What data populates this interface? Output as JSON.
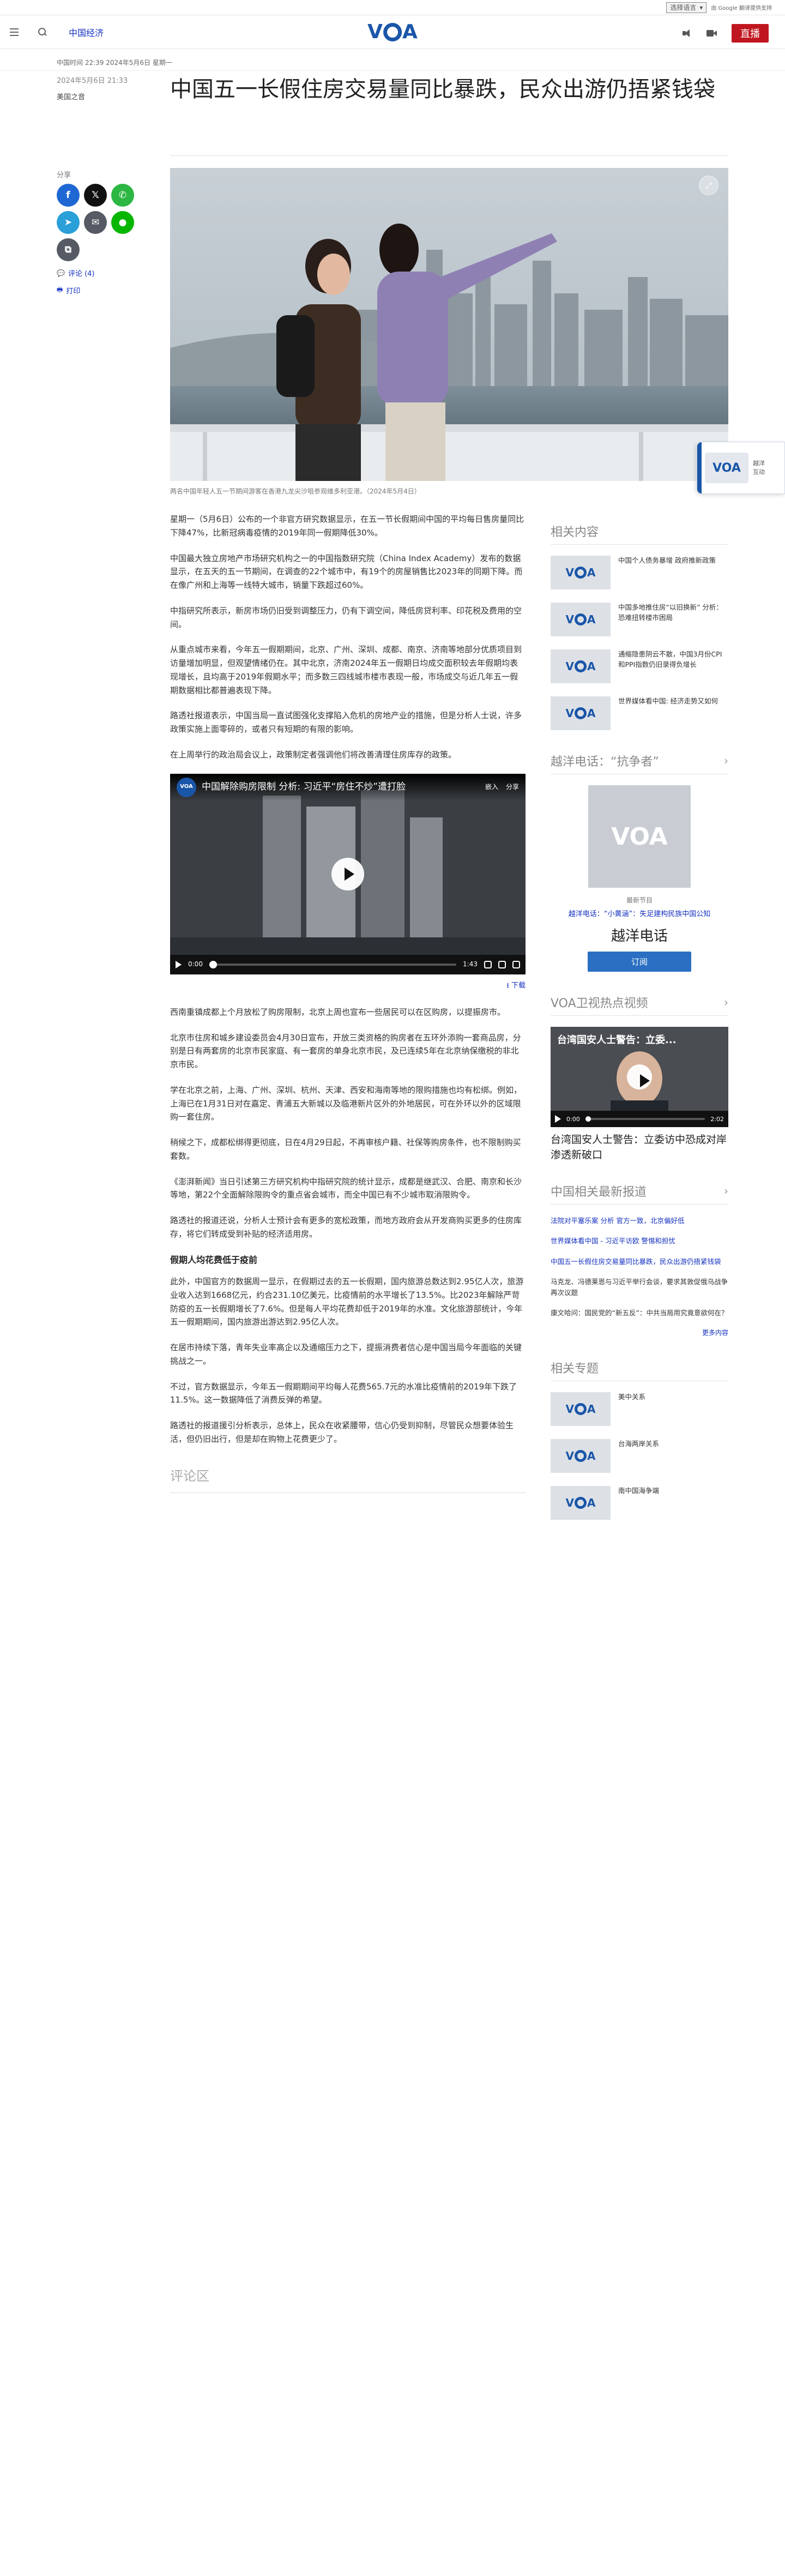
{
  "topbar": {
    "language_select": "选择语言",
    "powered_by": "由 Google 翻译提供支持"
  },
  "header": {
    "section": "中国经济",
    "logo": "VOA",
    "live": "直播"
  },
  "breadcrumb": "中国时间 22:39 2024年5月6日 星期一",
  "article": {
    "date": "2024年5月6日 21:33",
    "location": "美国之音",
    "title": "中国五一长假住房交易量同比暴跌，民众出游仍捂紧钱袋",
    "hero_caption": "两名中国年轻人五一节期间游客在香港九龙尖沙咀参观维多利亚港。（2024年5月4日）",
    "paragraphs_1": [
      "星期一（5月6日）公布的一个非官方研究数据显示，在五一节长假期间中国的平均每日售房量同比下降47%，比新冠病毒疫情的2019年同一假期降低30%。",
      "中国最大独立房地产市场研究机构之一的中国指数研究院（China Index Academy）发布的数据显示，在五天的五一节期间，在调查的22个城市中，有19个的房屋销售比2023年的同期下降。而在像广州和上海等一线特大城市，销量下跌超过60%。",
      "中指研究所表示，新房市场仍旧受到调整压力，仍有下调空间，降低房贷利率、印花税及费用的空间。",
      "从重点城市来看，今年五一假期期间，北京、广州、深圳、成都、南京、济南等地部分优质项目到访量增加明显，但观望情绪仍在。其中北京，济南2024年五一假期日均成交面积较去年假期均表现增长，且均高于2019年假期水平；而多数三四线城市楼市表现一般，市场成交与近几年五一假期数据相比都普遍表现下降。",
      "路透社报道表示，中国当局一直试图强化支撑陷入危机的房地产业的措施，但是分析人士说，许多政策实施上面零碎的，或者只有短期的有限的影响。",
      "在上周举行的政治局会议上，政策制定者强调他们将改善清理住房库存的政策。"
    ],
    "video": {
      "title": "中国解除购房限制 分析: 习近平“房住不炒”遭打脸",
      "embed": "嵌入",
      "share": "分享",
      "time_current": "0:00",
      "time_total": "1:43",
      "download": "下载"
    },
    "paragraphs_2": [
      "西南重镇成都上个月放松了购房限制，北京上周也宣布一些居民可以在区购房，以提振房市。",
      "北京市住房和城乡建设委员会4月30日宣布，开放三类资格的购房者在五环外添购一套商品房，分别是日有两套房的北京市民家庭、有一套房的单身北京市民，及已连续5年在北京纳保缴税的非北京市民。",
      "学在北京之前，上海、广州、深圳、杭州、天津、西安和海南等地的限购措施也均有松绑。例如，上海已在1月31日对在嘉定、青浦五大新城以及临港新片区外的外地居民，可在外环以外的区域限购一套住房。",
      "稍候之下，成都松绑得更彻底，日在4月29日起，不再审核户籍、社保等购房条件，也不限制购买套数。",
      "《澎湃新闻》当日引述第三方研究机构中指研究院的统计显示，成都是继武汉、合肥、南京和长沙等地，第22个全面解除限购令的重点省会城市，而全中国已有不少城市取消限购令。",
      "路透社的报道还说，分析人士预计会有更多的宽松政策，而地方政府会从开发商购买更多的住房库存，将它们转成受到补贴的经济适用房。"
    ],
    "subheading": "假期人均花费低于疫前",
    "paragraphs_3": [
      "此外，中国官方的数据周一显示，在假期过去的五一长假期，国内旅游总数达到2.95亿人次，旅游业收入达到1668亿元，约合231.10亿美元，比疫情前的水平增长了13.5%。比2023年解除严苛防疫的五一长假期增长了7.6%。但是每人平均花费却低于2019年的水准。文化旅游部统计，今年五一假期期间，国内旅游出游达到2.95亿人次。",
      "在居市持续下落，青年失业率高企以及通缩压力之下，提振消费者信心是中国当局今年面临的关键挑战之一。",
      "不过，官方数据显示，今年五一假期期间平均每人花费565.7元的水准比疫情前的2019年下跌了11.5%。这一数据降低了消费反弹的希望。",
      "路透社的报道援引分析表示，总体上，民众在收紧腰带，信心仍受到抑制，尽管民众想要体验生活，但仍旧出行，但是却在购物上花费更少了。"
    ],
    "comments_title": "评论区"
  },
  "share": {
    "label": "分享",
    "comments_link": "评论 (4)",
    "print_link": "打印"
  },
  "float_promo": {
    "text_1": "越洋",
    "text_2": "互动"
  },
  "sidebar": {
    "related_title": "相关内容",
    "related": [
      "中国个人债务暴增 政府推新政策",
      "中国多地推住房“以旧换新” 分析：恐难扭转楼市困局",
      "通缩隐患阴云不散，中国3月份CPI和PPI指数仍旧录得负增长",
      "世界媒体看中国: 经济走势又如何"
    ],
    "program_title": "越洋电话：“抗争者”",
    "program_label": "最新节目",
    "program_link": "越洋电话：“小黄涵”：失足建构民族中国公知",
    "program_name": "越洋电话",
    "subscribe": "订阅",
    "hotvideo_title": "VOA卫视热点视频",
    "hotvideo_overlay": "台湾国安人士警告：立委...",
    "hotvideo_time": "0:00",
    "hotvideo_total": "2:02",
    "hotvideo_caption": "台湾国安人士警告：立委访中恐成对岸渗透新破口",
    "news_title": "中国相关最新报道",
    "news": [
      "法院对平塞乐案 分析 官方一致，北京偏好低",
      "世界媒体看中国 - 习近平访欧 警惕和担忧",
      "中国五一长假住房交易量同比暴跌，民众出游仍捂紧钱袋",
      "马克龙、冯德莱恩与习近平举行会谈，要求其敦促俄乌战争再次议题",
      "康文哈问：国民党的“新五反”：中共当局用究竟意欲何在？"
    ],
    "more": "更多内容",
    "topics_title": "相关专题",
    "topics": [
      "美中关系",
      "台海两岸关系",
      "南中国海争端"
    ]
  }
}
